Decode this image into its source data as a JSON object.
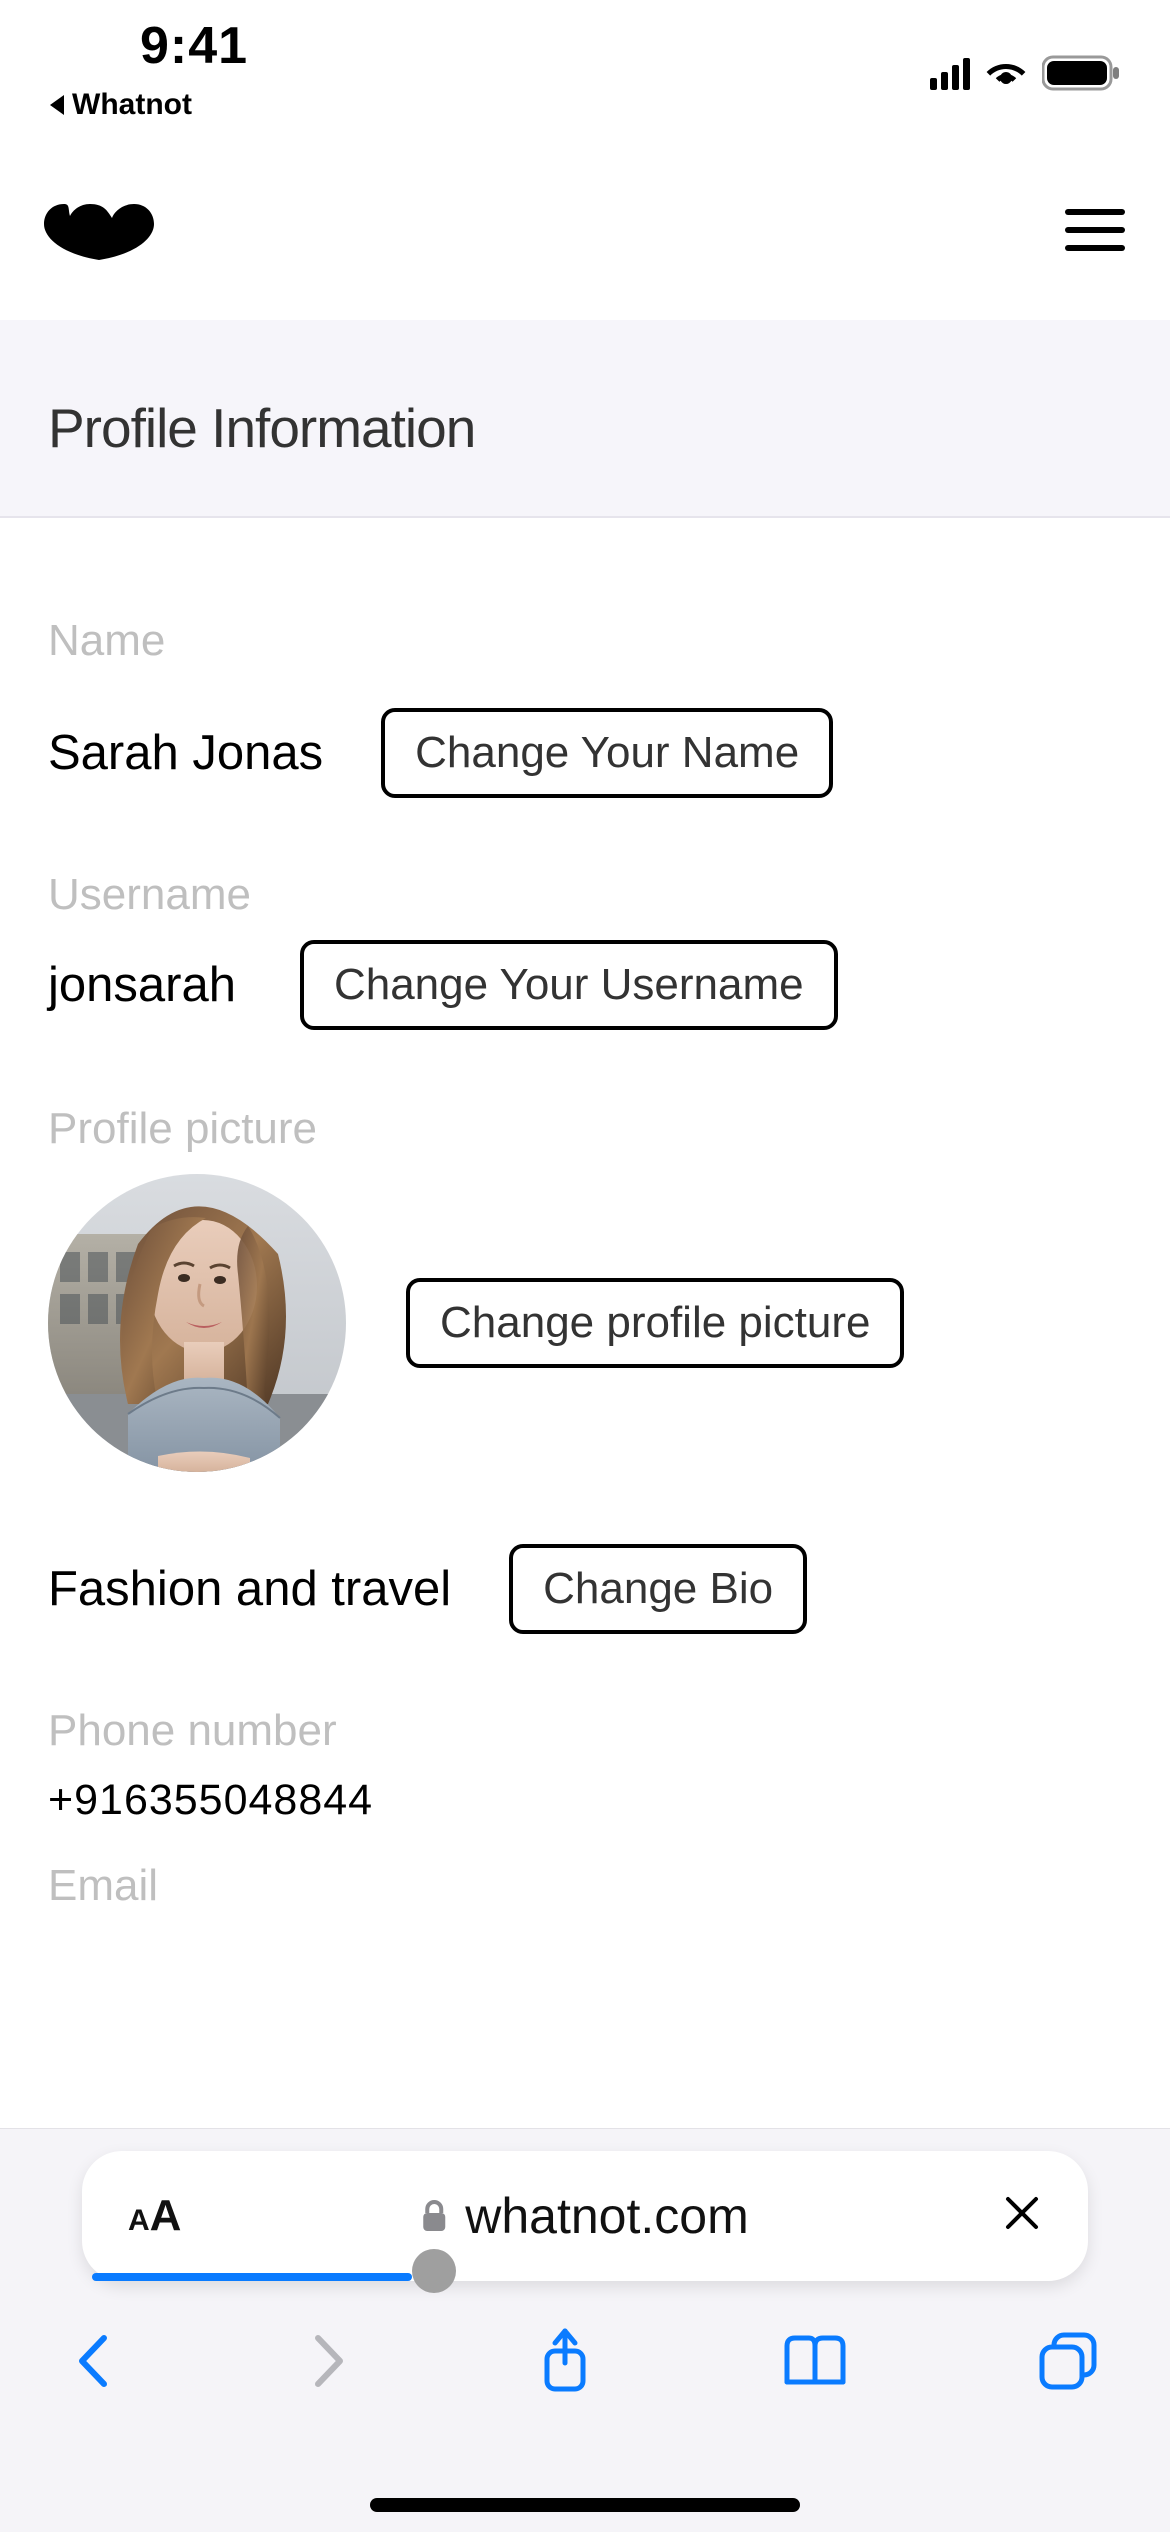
{
  "status": {
    "time": "9:41",
    "back_app": "Whatnot"
  },
  "page": {
    "title": "Profile Information"
  },
  "fields": {
    "name": {
      "label": "Name",
      "value": "Sarah Jonas",
      "button": "Change Your Name"
    },
    "username": {
      "label": "Username",
      "value": "jonsarah",
      "button": "Change Your Username"
    },
    "picture": {
      "label": "Profile picture",
      "button": "Change profile picture"
    },
    "bio": {
      "value": "Fashion and travel",
      "button": "Change Bio"
    },
    "phone": {
      "label": "Phone number",
      "value": "+916355048844"
    },
    "email": {
      "label": "Email"
    }
  },
  "browser": {
    "url": "whatnot.com"
  }
}
